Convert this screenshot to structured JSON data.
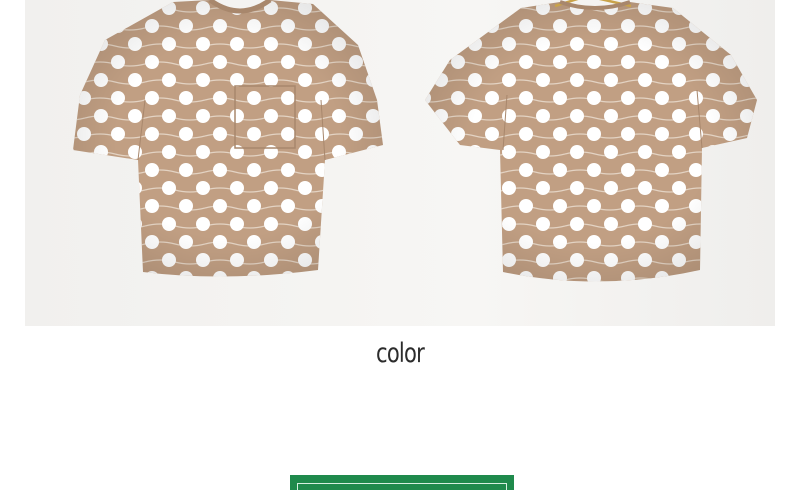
{
  "product_photo": {
    "shirt_color": "#c19f83",
    "dot_color": "#ffffff",
    "stitch_color": "#e3d3c3"
  },
  "section": {
    "title": "color"
  },
  "colors": {
    "accent": "#1f8a4c"
  }
}
